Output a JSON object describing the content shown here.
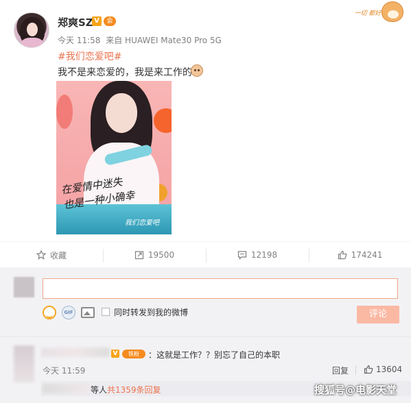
{
  "post": {
    "username": "郑爽SZ",
    "v_badge": "V",
    "vip_badge": "会",
    "time": "今天 11:58",
    "source": "来自 HUAWEI Mate30 Pro 5G",
    "hashtag": "#我们恋爱吧#",
    "text": "我不是来恋爱的，我是来工作的",
    "sticker_text": "一切 都好",
    "photo": {
      "script_line1": "在爱情中迷失",
      "script_line2": "也是一种小确幸",
      "logo": "我们恋爱吧"
    }
  },
  "actions": {
    "favorite_label": "收藏",
    "repost_count": "19500",
    "comment_count": "12198",
    "like_count": "174241"
  },
  "composer": {
    "gif_label": "GIF",
    "repost_checkbox_label": "同时转发到我的微博",
    "submit_label": "评论"
  },
  "comment": {
    "fan_badge": "铁粉",
    "text": "：这就是工作？？别忘了自己的本职",
    "time": "今天 11:59",
    "reply_label": "回复",
    "like_count": "13604",
    "more_prefix": "等人",
    "more_link": "共1359条回复"
  },
  "watermark": "搜狐号@电影天堂",
  "colors": {
    "accent": "#eb7350",
    "verified": "#f7a317",
    "submit_disabled": "#fbb9a4",
    "background_grey": "#f2f2f5"
  }
}
